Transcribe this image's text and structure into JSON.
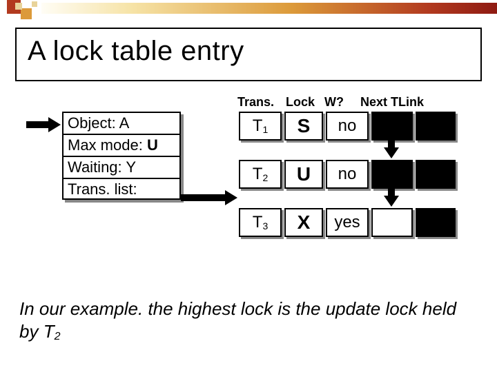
{
  "title": "A lock table entry",
  "object_box": {
    "object_label": "Object:  A",
    "maxmode_prefix": "Max mode: ",
    "maxmode_value": "U",
    "waiting": "Waiting: Y",
    "translist": " Trans. list:"
  },
  "headers": {
    "trans": "Trans.",
    "lock": "Lock",
    "w": "W?",
    "nexttlink": "Next TLink"
  },
  "rows": [
    {
      "t_label": "T",
      "t_sub": "1",
      "lock": "S",
      "w": "no"
    },
    {
      "t_label": "T",
      "t_sub": "2",
      "lock": "U",
      "w": "no"
    },
    {
      "t_label": "T",
      "t_sub": "3",
      "lock": "X",
      "w": "yes"
    }
  ],
  "caption_prefix": "In our example. the highest lock is the update lock held by ",
  "caption_t": "T",
  "caption_sub": "2",
  "chart_data": {
    "type": "table",
    "title": "A lock table entry",
    "object": "A",
    "max_mode": "U",
    "waiting": "Y",
    "columns": [
      "Trans.",
      "Lock",
      "W?",
      "Next TLink"
    ],
    "rows": [
      [
        "T1",
        "S",
        "no",
        null
      ],
      [
        "T2",
        "U",
        "no",
        null
      ],
      [
        "T3",
        "X",
        "yes",
        null
      ]
    ],
    "note": "In our example the highest lock is the update lock held by T2"
  }
}
